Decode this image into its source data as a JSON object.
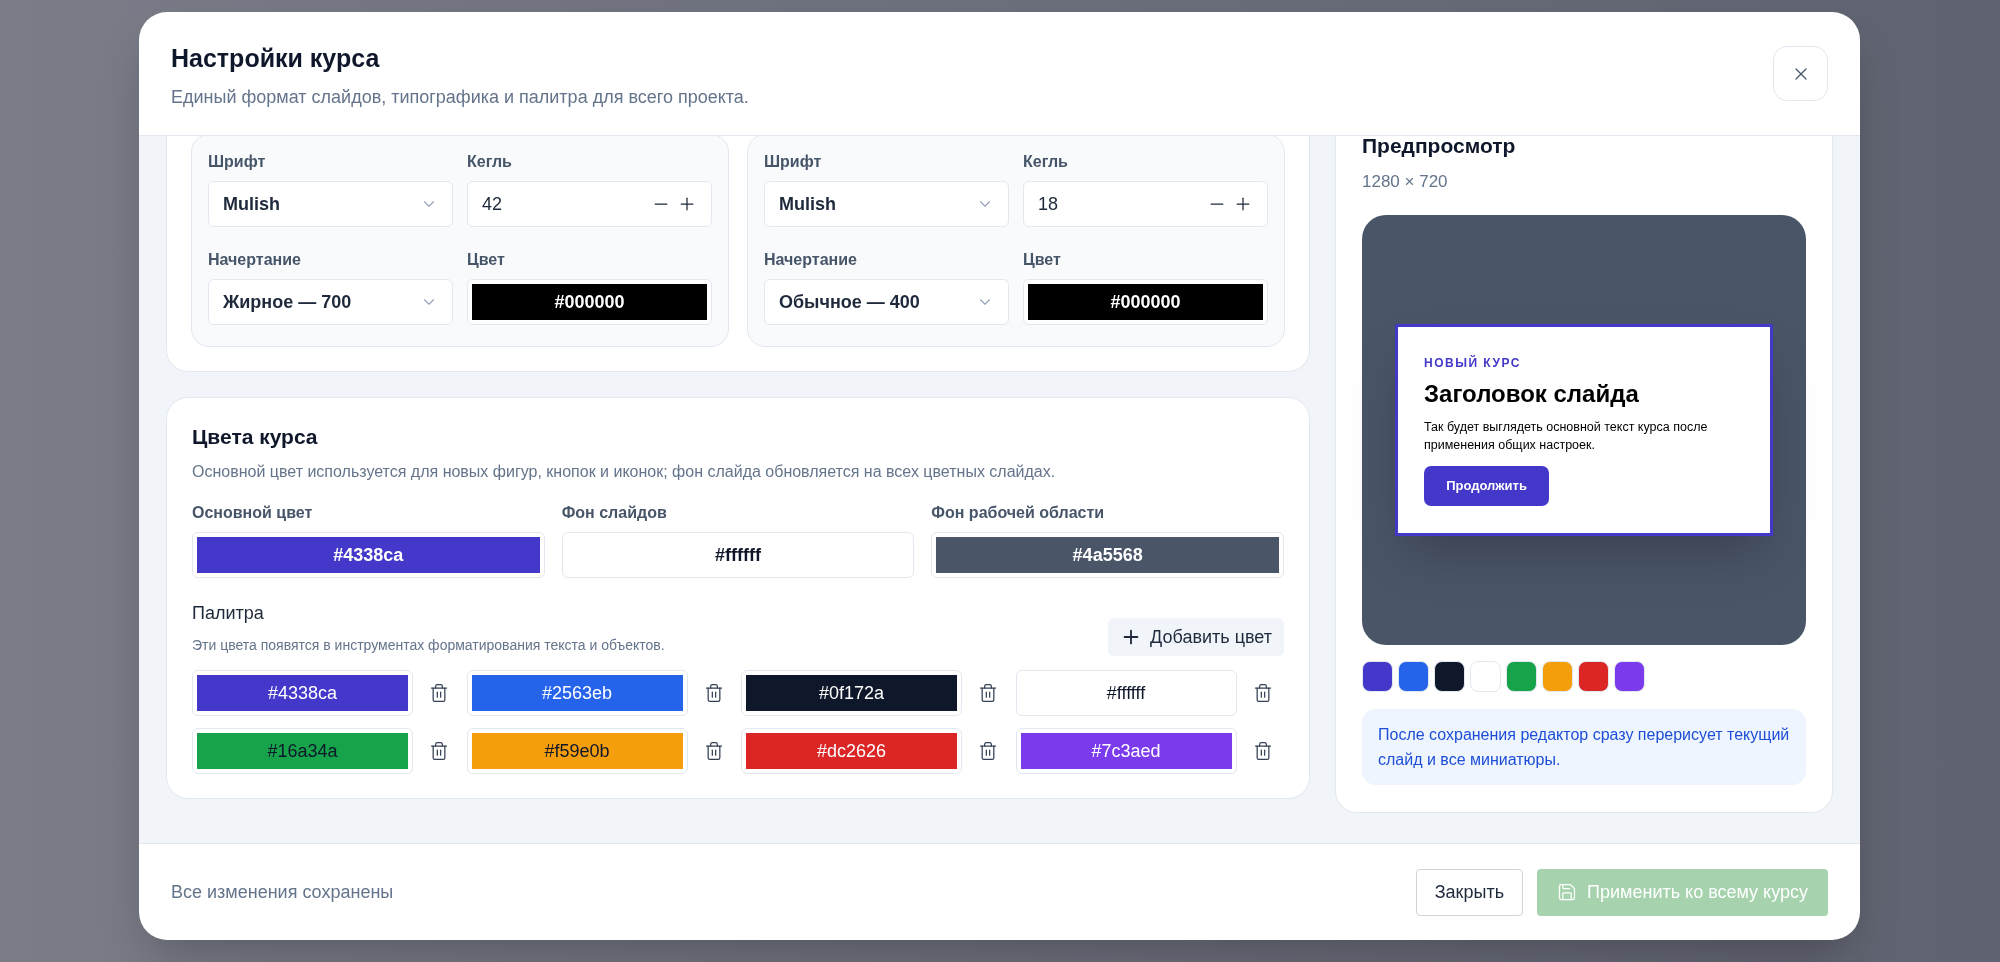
{
  "dialog": {
    "title": "Настройки курса",
    "subtitle": "Единый формат слайдов, типографика и палитра для всего проекта."
  },
  "typography_cards": [
    {
      "font": {
        "label": "Шрифт",
        "value": "Mulish"
      },
      "size": {
        "label": "Кегль",
        "value": "42"
      },
      "weight": {
        "label": "Начертание",
        "value": "Жирное — 700"
      },
      "color": {
        "label": "Цвет",
        "value": "#000000",
        "color": "#000000"
      }
    },
    {
      "font": {
        "label": "Шрифт",
        "value": "Mulish"
      },
      "size": {
        "label": "Кегль",
        "value": "18"
      },
      "weight": {
        "label": "Начертание",
        "value": "Обычное — 400"
      },
      "color": {
        "label": "Цвет",
        "value": "#000000",
        "color": "#000000"
      }
    }
  ],
  "course_colors": {
    "title": "Цвета курса",
    "description": "Основной цвет используется для новых фигур, кнопок и иконок; фон слайда обновляется на всех цветных слайдах.",
    "main": [
      {
        "label": "Основной цвет",
        "value": "#4338ca",
        "color": "#4338ca"
      },
      {
        "label": "Фон слайдов",
        "value": "#ffffff",
        "color": "#ffffff"
      },
      {
        "label": "Фон рабочей области",
        "value": "#4a5568",
        "color": "#4a5568"
      }
    ],
    "palette": {
      "label": "Палитра",
      "hint": "Эти цвета появятся в инструментах форматирования текста и объектов.",
      "add_button": "Добавить цвет",
      "items": [
        {
          "value": "#4338ca",
          "color": "#4338ca"
        },
        {
          "value": "#2563eb",
          "color": "#2563eb"
        },
        {
          "value": "#0f172a",
          "color": "#0f172a"
        },
        {
          "value": "#ffffff",
          "color": "#ffffff"
        },
        {
          "value": "#16a34a",
          "color": "#16a34a"
        },
        {
          "value": "#f59e0b",
          "color": "#f59e0b"
        },
        {
          "value": "#dc2626",
          "color": "#dc2626"
        },
        {
          "value": "#7c3aed",
          "color": "#7c3aed"
        }
      ]
    }
  },
  "preview": {
    "title": "Предпросмотр",
    "size": "1280 × 720",
    "slide": {
      "eyebrow": "НОВЫЙ КУРС",
      "heading": "Заголовок слайда",
      "body": "Так будет выглядеть основной текст курса после применения общих настроек.",
      "button": "Продолжить"
    },
    "swatches": [
      {
        "color": "#4338ca"
      },
      {
        "color": "#2563eb"
      },
      {
        "color": "#0f172a"
      },
      {
        "color": "#ffffff"
      },
      {
        "color": "#16a34a"
      },
      {
        "color": "#f59e0b"
      },
      {
        "color": "#dc2626"
      },
      {
        "color": "#7c3aed"
      }
    ],
    "note": "После сохранения редактор сразу перерисует текущий слайд и все миниатюры."
  },
  "footer": {
    "status": "Все изменения сохранены",
    "close_button": "Закрыть",
    "apply_button": {
      "label": "Применить ко всему курсу",
      "disabled": true
    }
  }
}
